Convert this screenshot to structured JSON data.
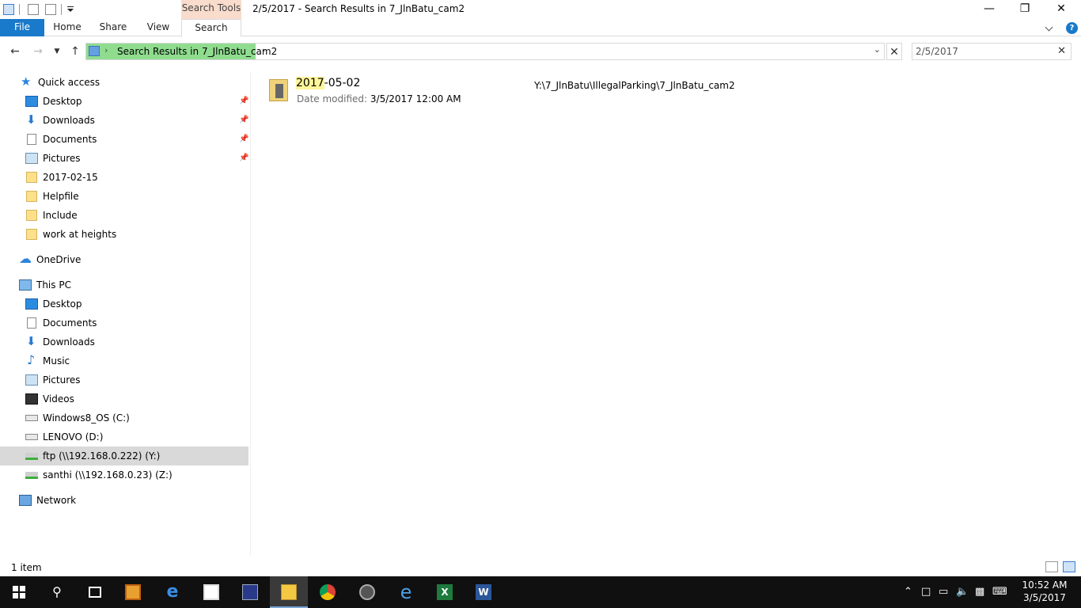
{
  "window": {
    "title": "2/5/2017 - Search Results in 7_JlnBatu_cam2",
    "context_tab": "Search Tools"
  },
  "ribbon": {
    "tabs": [
      {
        "label": "File"
      },
      {
        "label": "Home"
      },
      {
        "label": "Share"
      },
      {
        "label": "View"
      },
      {
        "label": "Search"
      }
    ],
    "active_tab": "Search",
    "help_glyph": "?"
  },
  "address": {
    "path": "Search Results in 7_JlnBatu_cam2",
    "search_value": "2/5/2017"
  },
  "nav": {
    "quick_access": "Quick access",
    "quick_items": [
      {
        "label": "Desktop",
        "icon": "desktop-icon",
        "pinned": true
      },
      {
        "label": "Downloads",
        "icon": "downloads-icon",
        "pinned": true
      },
      {
        "label": "Documents",
        "icon": "documents-icon",
        "pinned": true
      },
      {
        "label": "Pictures",
        "icon": "pictures-icon",
        "pinned": true
      },
      {
        "label": "2017-02-15",
        "icon": "folder-icon",
        "pinned": false
      },
      {
        "label": "Helpfile",
        "icon": "folder-icon",
        "pinned": false
      },
      {
        "label": "Include",
        "icon": "folder-icon",
        "pinned": false
      },
      {
        "label": "work at heights",
        "icon": "folder-icon",
        "pinned": false
      }
    ],
    "onedrive": "OneDrive",
    "this_pc": "This PC",
    "pc_items": [
      {
        "label": "Desktop",
        "icon": "desktop-icon"
      },
      {
        "label": "Documents",
        "icon": "documents-icon"
      },
      {
        "label": "Downloads",
        "icon": "downloads-icon"
      },
      {
        "label": "Music",
        "icon": "music-icon"
      },
      {
        "label": "Pictures",
        "icon": "pictures-icon"
      },
      {
        "label": "Videos",
        "icon": "videos-icon"
      },
      {
        "label": "Windows8_OS (C:)",
        "icon": "drive-icon"
      },
      {
        "label": "LENOVO (D:)",
        "icon": "drive-icon"
      },
      {
        "label": "ftp (\\\\192.168.0.222) (Y:)",
        "icon": "network-drive-icon",
        "selected": true
      },
      {
        "label": "santhi (\\\\192.168.0.23) (Z:)",
        "icon": "network-drive-icon"
      }
    ],
    "network": "Network"
  },
  "results": [
    {
      "name_highlight": "2017",
      "name_rest": "-05-02",
      "date_label": "Date modified:",
      "date_value": "3/5/2017 12:00 AM",
      "path": "Y:\\7_JlnBatu\\IllegalParking\\7_JlnBatu_cam2"
    }
  ],
  "status": {
    "item_count": "1 item"
  },
  "taskbar": {
    "apps": [
      "start-icon",
      "search-icon",
      "task-view-icon",
      "media-player-icon",
      "edge-icon",
      "store-icon",
      "app-icon",
      "file-explorer-icon",
      "chrome-icon",
      "app-icon-2",
      "ie-icon",
      "excel-icon",
      "word-icon"
    ],
    "time": "10:52 AM",
    "date": "3/5/2017"
  },
  "colors": {
    "file_tab": "#1979ca",
    "search_tools": "#f9dccc",
    "address_highlight": "#8fdc8f",
    "search_highlight": "#fff59a",
    "taskbar": "#101010"
  }
}
